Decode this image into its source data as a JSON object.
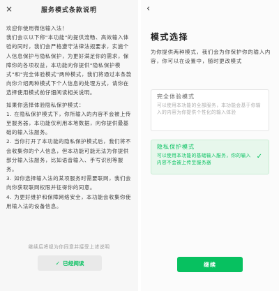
{
  "left_panel": {
    "title": "服务模式条款说明",
    "close_icon": "×",
    "paragraphs": [
      "欢迎你使用微信输入法！",
      "我们会以以下称\"本功能\"的提供流畅、高效输入体验的同时，我们会严格遵守法律法规要求，实施个人信息保护与隐私保护，为更好满足你的需求，保障你的各项权益，本功能向你提供\"隐私保护模式\"和\"完全体验模式\"两种模式，我们将通过本条款向你介绍两种模式下个人信息的处理方式，请你在选择使用模式前仔细阅读相关说明。",
      "如果你选择体验隐私保护模式：",
      "1. 在隐私保护模式下，你所输入的内容不会被上传至服务器，本功能仅利用本地数据，向你提供最基础的输入法服务。",
      "2. 当你打开了本功能的隐私保护模式后，我们将不会收集你的个人信息，但本功能可能无法为你提供部分输入法服务，比如语音输入、手写识别等服务。",
      "3. 如你选择输入法的某项服务时需要联网，我们会向你获取联网权限并征得你的同意。",
      "4. 为更好维护和保障网络安全，本功能会收集你使用输入法的设备信息。"
    ],
    "footer_note": "继续后将视为你同意并接受上述说明",
    "agree_button": "已经阅读",
    "check_icon": "✓"
  },
  "right_panel": {
    "back_icon": "‹",
    "heading": "模式选择",
    "description": "为你提供两种模式，我们会为你保护你的输入内容，你可以在设置中，随时更改模式",
    "modes": [
      {
        "title": "完全体验模式",
        "description": "可以使用本功能的全部服务，本功能会基于你输入的内容为你提供个性化的输入体验",
        "selected": false
      },
      {
        "title": "隐私保护模式",
        "description": "可以使用本功能的基础输入服务，你的输入内容不会被上传至服务器",
        "selected": true
      }
    ],
    "selected_check_icon": "✓",
    "continue_button": "继续"
  },
  "colors": {
    "accent": "#07c160",
    "selected_card_bg": "#e7f7ec",
    "left_bg": "#f7f7f7",
    "right_bg": "#fbfbfb"
  }
}
